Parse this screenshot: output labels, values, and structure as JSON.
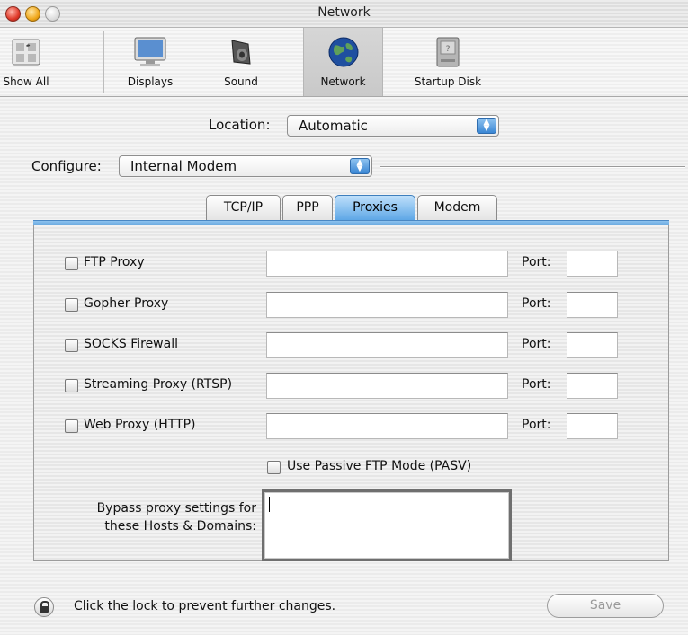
{
  "window": {
    "title": "Network"
  },
  "toolbar": {
    "items": [
      {
        "label": "Show All",
        "icon": "apple-prefs-icon"
      },
      {
        "label": "Displays",
        "icon": "display-monitor-icon"
      },
      {
        "label": "Sound",
        "icon": "speaker-icon"
      },
      {
        "label": "Network",
        "icon": "globe-icon",
        "active": true
      },
      {
        "label": "Startup Disk",
        "icon": "hard-disk-icon"
      }
    ]
  },
  "location": {
    "label": "Location:",
    "value": "Automatic"
  },
  "configure": {
    "label": "Configure:",
    "value": "Internal Modem"
  },
  "tabs": [
    {
      "label": "TCP/IP"
    },
    {
      "label": "PPP"
    },
    {
      "label": "Proxies",
      "active": true
    },
    {
      "label": "Modem"
    }
  ],
  "proxies": {
    "port_label": "Port:",
    "rows": [
      {
        "label": "FTP Proxy",
        "checked": false,
        "host": "",
        "port": ""
      },
      {
        "label": "Gopher Proxy",
        "checked": false,
        "host": "",
        "port": ""
      },
      {
        "label": "SOCKS Firewall",
        "checked": false,
        "host": "",
        "port": ""
      },
      {
        "label": "Streaming Proxy (RTSP)",
        "checked": false,
        "host": "",
        "port": ""
      },
      {
        "label": "Web Proxy (HTTP)",
        "checked": false,
        "host": "",
        "port": ""
      }
    ],
    "passive_ftp": {
      "label": "Use Passive FTP Mode (PASV)",
      "checked": false
    },
    "bypass": {
      "label_line1": "Bypass proxy settings for",
      "label_line2": "these Hosts & Domains:",
      "value": ""
    }
  },
  "footer": {
    "lock_text": "Click the lock to prevent further changes.",
    "save_label": "Save"
  },
  "colors": {
    "tab_active": "#5ea7e6",
    "tab_rule": "#8ec3ef"
  }
}
